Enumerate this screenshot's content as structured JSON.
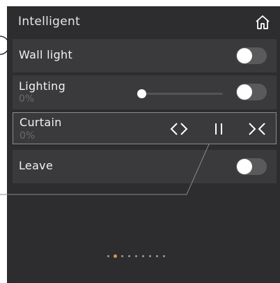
{
  "header": {
    "title": "Intelligent",
    "home_icon": "home-icon"
  },
  "rows": [
    {
      "label": "Wall light",
      "control": "toggle",
      "on": false
    },
    {
      "label": "Lighting",
      "sub": "0%",
      "control": "slider+toggle",
      "slider_value_percent": 0,
      "on": false
    },
    {
      "label": "Curtain",
      "sub": "0%",
      "control": "curtain-buttons",
      "buttons": [
        "open-icon",
        "pause-icon",
        "close-icon"
      ]
    },
    {
      "label": "Leave",
      "control": "toggle",
      "on": false
    }
  ],
  "pagination": {
    "count": 9,
    "active": 1
  },
  "colors": {
    "panel_bg": "#2d2d2f",
    "row_bg": "#3a3a3c",
    "accent_dot": "#d29c3e",
    "callout_border": "#8a8a8a"
  }
}
